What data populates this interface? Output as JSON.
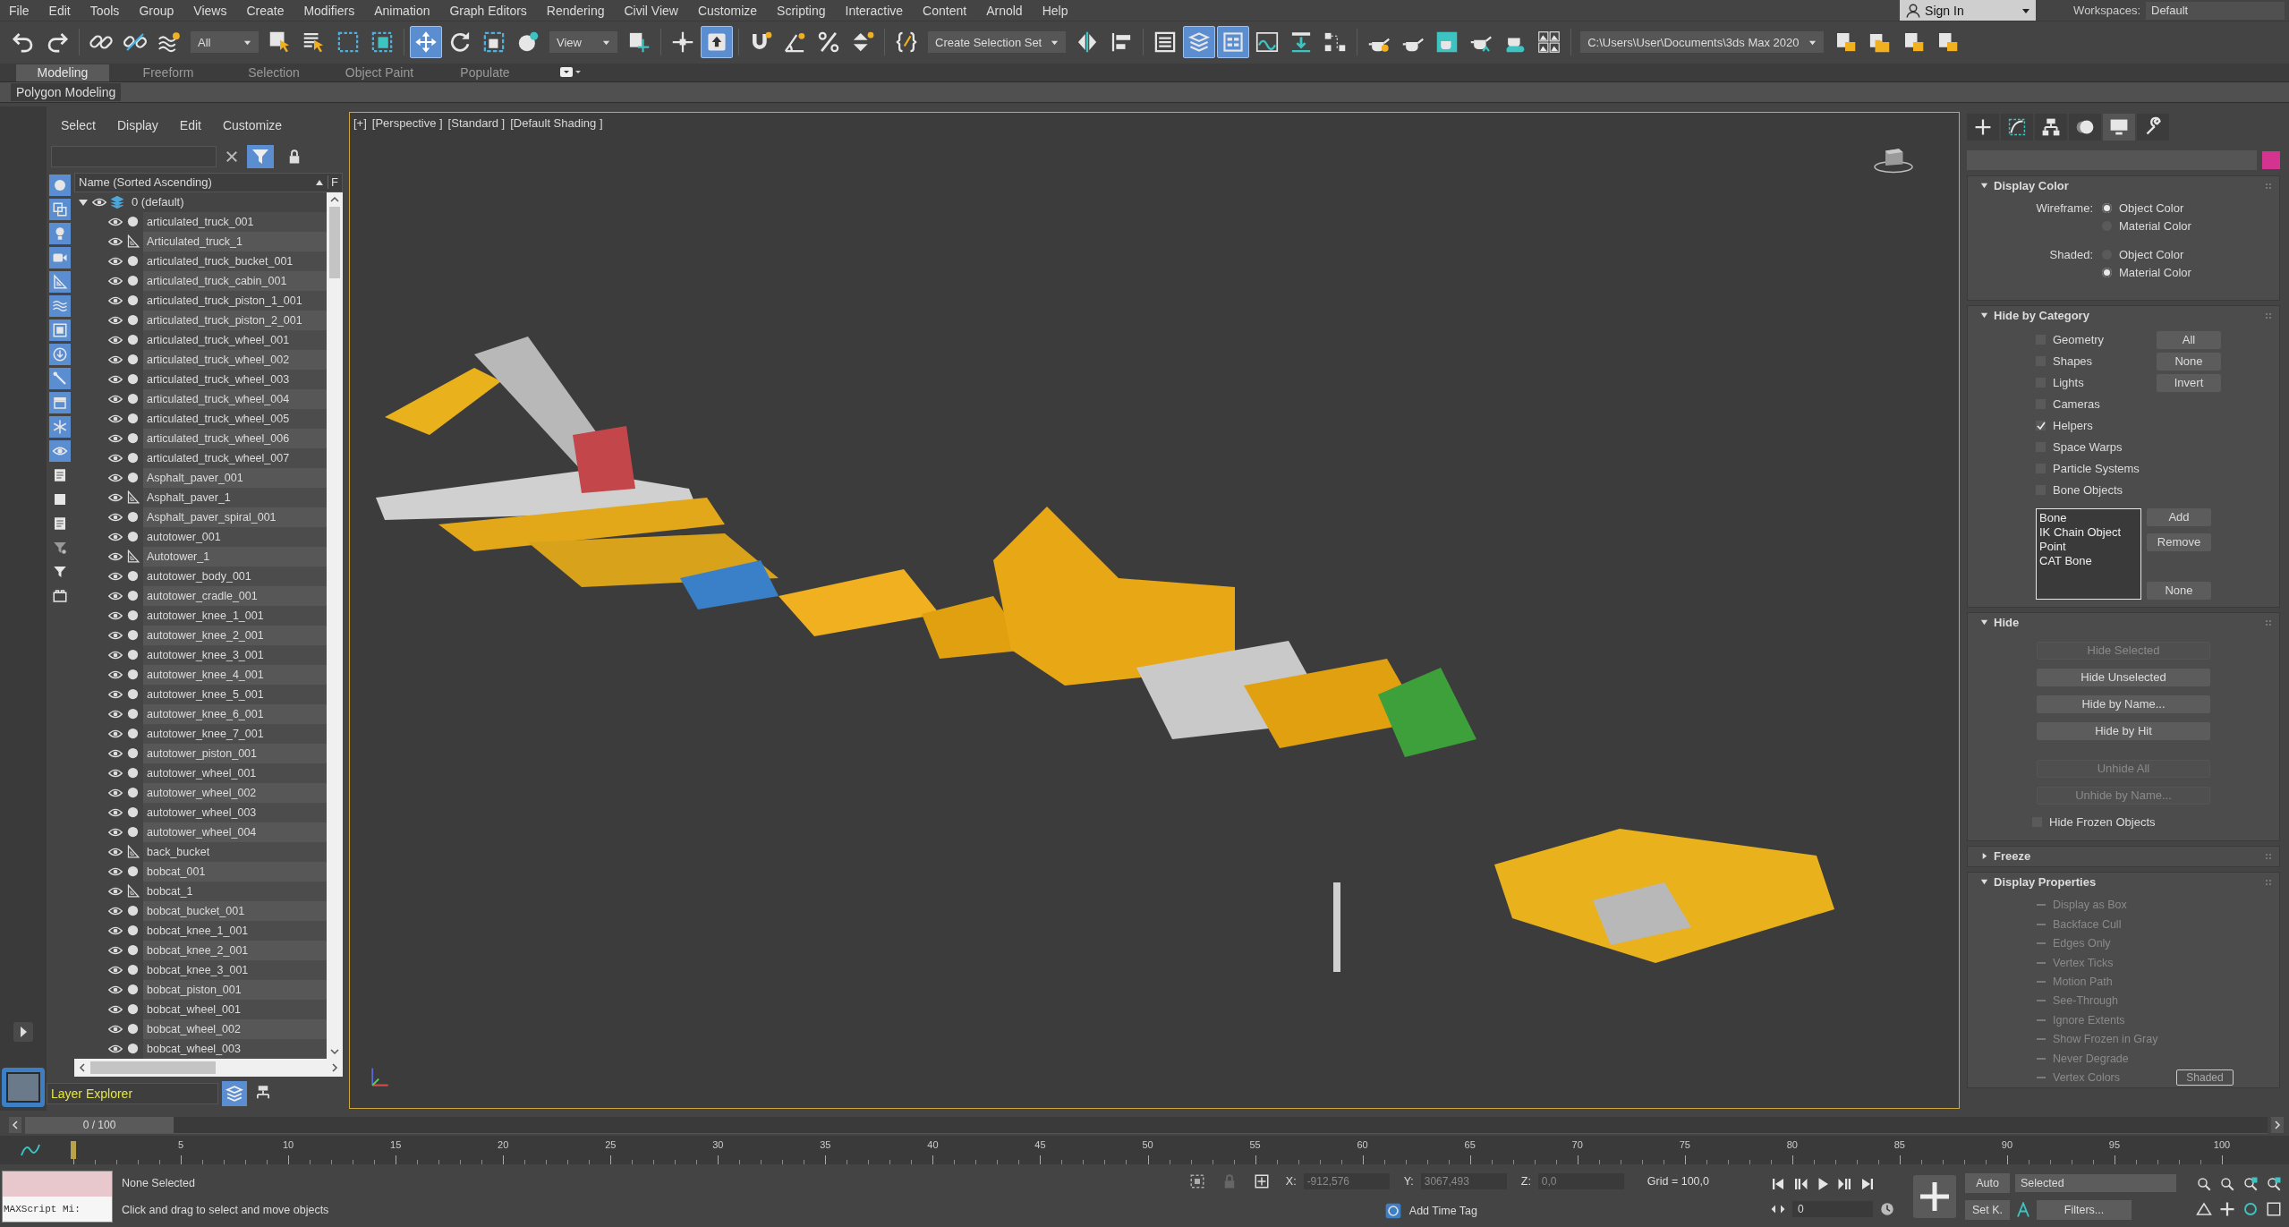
{
  "menu_bar": [
    "File",
    "Edit",
    "Tools",
    "Group",
    "Views",
    "Create",
    "Modifiers",
    "Animation",
    "Graph Editors",
    "Rendering",
    "Civil View",
    "Customize",
    "Scripting",
    "Interactive",
    "Content",
    "Arnold",
    "Help"
  ],
  "sign_in": "Sign In",
  "workspaces": {
    "label": "Workspaces:",
    "value": "Default"
  },
  "toolbar": [
    {
      "kind": "undo",
      "on": false
    },
    {
      "kind": "redo",
      "on": false
    },
    {
      "kind": "sep"
    },
    {
      "kind": "link",
      "on": false
    },
    {
      "kind": "unlink",
      "on": false
    },
    {
      "kind": "bind",
      "on": false
    },
    {
      "kind": "dropdown",
      "value": "All"
    },
    {
      "kind": "select",
      "on": false
    },
    {
      "kind": "select-name",
      "on": false
    },
    {
      "kind": "region",
      "on": false
    },
    {
      "kind": "window",
      "on": false
    },
    {
      "kind": "sep"
    },
    {
      "kind": "move",
      "on": true
    },
    {
      "kind": "rotate",
      "on": false
    },
    {
      "kind": "scale",
      "on": false
    },
    {
      "kind": "place",
      "on": false
    },
    {
      "kind": "dropdown",
      "value": "View"
    },
    {
      "kind": "pivot",
      "on": false
    },
    {
      "kind": "sep"
    },
    {
      "kind": "manipulate",
      "on": false
    },
    {
      "kind": "shortcut",
      "on": true
    },
    {
      "kind": "sep"
    },
    {
      "kind": "snap",
      "on": false
    },
    {
      "kind": "angle",
      "on": false
    },
    {
      "kind": "percent",
      "on": false
    },
    {
      "kind": "spinner",
      "on": false
    },
    {
      "kind": "sep"
    },
    {
      "kind": "named-sets",
      "on": false
    },
    {
      "kind": "dropdown",
      "value": "Create Selection Set"
    },
    {
      "kind": "mirror",
      "on": false
    },
    {
      "kind": "align",
      "on": false
    },
    {
      "kind": "sep"
    },
    {
      "kind": "explorer",
      "on": false
    },
    {
      "kind": "layers",
      "on": true
    },
    {
      "kind": "ribbon",
      "on": true
    },
    {
      "kind": "curve",
      "on": false
    },
    {
      "kind": "dope",
      "on": false
    },
    {
      "kind": "schematic",
      "on": false
    },
    {
      "kind": "sep"
    },
    {
      "kind": "material",
      "on": false
    },
    {
      "kind": "render-setup",
      "on": false
    },
    {
      "kind": "frame-window",
      "on": false
    },
    {
      "kind": "render",
      "on": false
    },
    {
      "kind": "cloud",
      "on": false
    },
    {
      "kind": "gallery",
      "on": false
    },
    {
      "kind": "sep"
    },
    {
      "kind": "dropdown",
      "value": "C:\\Users\\User\\Documents\\3ds Max 2020"
    },
    {
      "kind": "project",
      "on": false
    },
    {
      "kind": "folder",
      "on": false
    },
    {
      "kind": "project",
      "on": false
    },
    {
      "kind": "project",
      "on": false
    }
  ],
  "ribbon": {
    "tabs": [
      {
        "label": "Modeling",
        "selected": true
      },
      {
        "label": "Freeform",
        "selected": false
      },
      {
        "label": "Selection",
        "selected": false
      },
      {
        "label": "Object Paint",
        "selected": false
      },
      {
        "label": "Populate",
        "selected": false
      }
    ],
    "panel": "Polygon Modeling"
  },
  "scene_explorer": {
    "menu": [
      "Select",
      "Display",
      "Edit",
      "Customize"
    ],
    "filters": [
      {
        "kind": "geometry",
        "on": true
      },
      {
        "kind": "shapes",
        "on": true
      },
      {
        "kind": "lights",
        "on": true
      },
      {
        "kind": "cameras",
        "on": true
      },
      {
        "kind": "helpers",
        "on": true
      },
      {
        "kind": "spacewarps",
        "on": true
      },
      {
        "kind": "groups",
        "on": true
      },
      {
        "kind": "xrefs",
        "on": true
      },
      {
        "kind": "bones",
        "on": true
      },
      {
        "kind": "containers",
        "on": true
      },
      {
        "kind": "frozen",
        "on": true
      },
      {
        "kind": "hidden",
        "on": true
      },
      {
        "kind": "list",
        "on": false
      },
      {
        "kind": "square",
        "on": false
      },
      {
        "kind": "list",
        "on": false
      },
      {
        "kind": "filter-gear",
        "on": false
      },
      {
        "kind": "filter",
        "on": false
      },
      {
        "kind": "box",
        "on": false
      }
    ],
    "columns": [
      "Name (Sorted Ascending)",
      "F"
    ],
    "layer": {
      "name": "0 (default)",
      "expanded": true,
      "children": [
        {
          "name": "articulated_truck_001",
          "kind": "geometry",
          "visible": true
        },
        {
          "name": "Articulated_truck_1",
          "kind": "shape",
          "visible": true
        },
        {
          "name": "articulated_truck_bucket_001",
          "kind": "geometry",
          "visible": true
        },
        {
          "name": "articulated_truck_cabin_001",
          "kind": "geometry",
          "visible": true
        },
        {
          "name": "articulated_truck_piston_1_001",
          "kind": "geometry",
          "visible": true
        },
        {
          "name": "articulated_truck_piston_2_001",
          "kind": "geometry",
          "visible": true
        },
        {
          "name": "articulated_truck_wheel_001",
          "kind": "geometry",
          "visible": true
        },
        {
          "name": "articulated_truck_wheel_002",
          "kind": "geometry",
          "visible": true
        },
        {
          "name": "articulated_truck_wheel_003",
          "kind": "geometry",
          "visible": true
        },
        {
          "name": "articulated_truck_wheel_004",
          "kind": "geometry",
          "visible": true
        },
        {
          "name": "articulated_truck_wheel_005",
          "kind": "geometry",
          "visible": true
        },
        {
          "name": "articulated_truck_wheel_006",
          "kind": "geometry",
          "visible": true
        },
        {
          "name": "articulated_truck_wheel_007",
          "kind": "geometry",
          "visible": true
        },
        {
          "name": "Asphalt_paver_001",
          "kind": "geometry",
          "visible": true
        },
        {
          "name": "Asphalt_paver_1",
          "kind": "shape",
          "visible": true
        },
        {
          "name": "Asphalt_paver_spiral_001",
          "kind": "geometry",
          "visible": true
        },
        {
          "name": "autotower_001",
          "kind": "geometry",
          "visible": true
        },
        {
          "name": "Autotower_1",
          "kind": "shape",
          "visible": true
        },
        {
          "name": "autotower_body_001",
          "kind": "geometry",
          "visible": true
        },
        {
          "name": "autotower_cradle_001",
          "kind": "geometry",
          "visible": true
        },
        {
          "name": "autotower_knee_1_001",
          "kind": "geometry",
          "visible": true
        },
        {
          "name": "autotower_knee_2_001",
          "kind": "geometry",
          "visible": true
        },
        {
          "name": "autotower_knee_3_001",
          "kind": "geometry",
          "visible": true
        },
        {
          "name": "autotower_knee_4_001",
          "kind": "geometry",
          "visible": true
        },
        {
          "name": "autotower_knee_5_001",
          "kind": "geometry",
          "visible": true
        },
        {
          "name": "autotower_knee_6_001",
          "kind": "geometry",
          "visible": true
        },
        {
          "name": "autotower_knee_7_001",
          "kind": "geometry",
          "visible": true
        },
        {
          "name": "autotower_piston_001",
          "kind": "geometry",
          "visible": true
        },
        {
          "name": "autotower_wheel_001",
          "kind": "geometry",
          "visible": true
        },
        {
          "name": "autotower_wheel_002",
          "kind": "geometry",
          "visible": true
        },
        {
          "name": "autotower_wheel_003",
          "kind": "geometry",
          "visible": true
        },
        {
          "name": "autotower_wheel_004",
          "kind": "geometry",
          "visible": true
        },
        {
          "name": "back_bucket",
          "kind": "shape",
          "visible": true
        },
        {
          "name": "bobcat_001",
          "kind": "geometry",
          "visible": true
        },
        {
          "name": "bobcat_1",
          "kind": "shape",
          "visible": true
        },
        {
          "name": "bobcat_bucket_001",
          "kind": "geometry",
          "visible": true
        },
        {
          "name": "bobcat_knee_1_001",
          "kind": "geometry",
          "visible": true
        },
        {
          "name": "bobcat_knee_2_001",
          "kind": "geometry",
          "visible": true
        },
        {
          "name": "bobcat_knee_3_001",
          "kind": "geometry",
          "visible": true
        },
        {
          "name": "bobcat_piston_001",
          "kind": "geometry",
          "visible": true
        },
        {
          "name": "bobcat_wheel_001",
          "kind": "geometry",
          "visible": true
        },
        {
          "name": "bobcat_wheel_002",
          "kind": "geometry",
          "visible": true
        },
        {
          "name": "bobcat_wheel_003",
          "kind": "geometry",
          "visible": true
        }
      ]
    },
    "explorer_type": "Layer Explorer"
  },
  "viewport": {
    "labels": [
      "[+]",
      "[Perspective ]",
      "[Standard ]",
      "[Default Shading ]"
    ],
    "kind": "picture"
  },
  "command_panel": {
    "tabs": [
      {
        "kind": "create",
        "selected": false
      },
      {
        "kind": "modify",
        "selected": false
      },
      {
        "kind": "hierarchy",
        "selected": false
      },
      {
        "kind": "motion",
        "selected": false
      },
      {
        "kind": "display",
        "selected": true
      },
      {
        "kind": "utilities",
        "selected": false
      }
    ],
    "rollouts": [
      {
        "title": "Display Color",
        "expanded": true,
        "kind": "radios",
        "groups": [
          {
            "label": "Wireframe:",
            "options": [
              {
                "label": "Object Color",
                "selected": true
              },
              {
                "label": "Material Color",
                "selected": false
              }
            ]
          },
          {
            "label": "Shaded:",
            "options": [
              {
                "label": "Object Color",
                "selected": false
              },
              {
                "label": "Material Color",
                "selected": true
              }
            ]
          }
        ]
      },
      {
        "title": "Hide by Category",
        "expanded": true,
        "kind": "category",
        "checks": [
          {
            "label": "Geometry",
            "checked": false
          },
          {
            "label": "Shapes",
            "checked": false
          },
          {
            "label": "Lights",
            "checked": false
          },
          {
            "label": "Cameras",
            "checked": false
          },
          {
            "label": "Helpers",
            "checked": true
          },
          {
            "label": "Space Warps",
            "checked": false
          },
          {
            "label": "Particle Systems",
            "checked": false
          },
          {
            "label": "Bone Objects",
            "checked": false
          }
        ],
        "side_buttons": [
          "All",
          "None",
          "Invert"
        ],
        "list": [
          "Bone",
          "IK Chain Object",
          "Point",
          "CAT Bone"
        ],
        "list_buttons": [
          "Add",
          "Remove"
        ],
        "list_bottom_button": "None"
      },
      {
        "title": "Hide",
        "expanded": true,
        "kind": "buttons",
        "button_groups": [
          [
            {
              "label": "Hide Selected",
              "disabled": true
            },
            {
              "label": "Hide Unselected",
              "disabled": false
            },
            {
              "label": "Hide by Name...",
              "disabled": false
            },
            {
              "label": "Hide by Hit",
              "disabled": false
            }
          ],
          [
            {
              "label": "Unhide All",
              "disabled": true
            },
            {
              "label": "Unhide by Name...",
              "disabled": true
            }
          ]
        ],
        "checks": [
          {
            "label": "Hide Frozen Objects",
            "checked": false
          }
        ]
      },
      {
        "title": "Freeze",
        "expanded": false,
        "kind": "buttons"
      },
      {
        "title": "Display Properties",
        "expanded": true,
        "kind": "props",
        "props": [
          {
            "label": "Display as Box",
            "disabled": true
          },
          {
            "label": "Backface Cull",
            "disabled": true
          },
          {
            "label": "Edges Only",
            "disabled": true
          },
          {
            "label": "Vertex Ticks",
            "disabled": true
          },
          {
            "label": "Motion Path",
            "disabled": true
          },
          {
            "label": "See-Through",
            "disabled": true
          },
          {
            "label": "Ignore Extents",
            "disabled": true
          },
          {
            "label": "Show Frozen in Gray",
            "disabled": true
          },
          {
            "label": "Never Degrade",
            "disabled": true
          },
          {
            "label": "Vertex Colors",
            "disabled": true
          }
        ],
        "side_button": "Shaded"
      }
    ]
  },
  "time_slider": {
    "label": "0 / 100",
    "level": 0
  },
  "ruler": {
    "ticks": [
      "5",
      "10",
      "15",
      "20",
      "25",
      "30",
      "35",
      "40",
      "45",
      "50",
      "55",
      "60",
      "65",
      "70",
      "75",
      "80",
      "85",
      "90",
      "95",
      "100"
    ]
  },
  "status_bar": {
    "maxscript": "MAXScript Mi:",
    "prompt": "None Selected",
    "hint": "Click and drag to select and move objects",
    "coords": [
      {
        "label": "X:",
        "value": "-912,576"
      },
      {
        "label": "Y:",
        "value": "3067,493"
      },
      {
        "label": "Z:",
        "value": "0,0"
      }
    ],
    "grid": "Grid = 100,0",
    "add_time_tag": "Add Time Tag",
    "frame": "0",
    "auto": "Auto",
    "key_mode": "Selected",
    "set_key": "Set K.",
    "filters": "Filters..."
  }
}
